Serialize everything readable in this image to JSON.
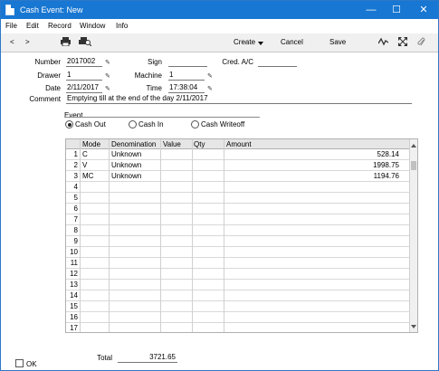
{
  "window": {
    "title": "Cash Event: New",
    "controls": {
      "minimize": "—",
      "maximize": "☐",
      "close": "✕"
    }
  },
  "menu": [
    "File",
    "Edit",
    "Record",
    "Window",
    "Info"
  ],
  "toolbar": {
    "prev": "<",
    "next": ">",
    "create_label": "Create",
    "cancel_label": "Cancel",
    "save_label": "Save"
  },
  "header": {
    "number_label": "Number",
    "number_value": "2017002",
    "drawer_label": "Drawer",
    "drawer_value": "1",
    "date_label": "Date",
    "date_value": "2/11/2017",
    "sign_label": "Sign",
    "sign_value": "",
    "machine_label": "Machine",
    "machine_value": "1",
    "time_label": "Time",
    "time_value": "17:38:04",
    "cred_label": "Cred. A/C",
    "cred_value": "",
    "comment_label": "Comment",
    "comment_value": "Emptying till at the end of the day 2/11/2017"
  },
  "event": {
    "label": "Event",
    "options": [
      "Cash Out",
      "Cash In",
      "Cash Writeoff"
    ],
    "selected": "Cash Out"
  },
  "table": {
    "columns": [
      "Mode",
      "Denomination",
      "Value",
      "Qty",
      "Amount"
    ],
    "row_numbers": [
      "1",
      "2",
      "3",
      "4",
      "5",
      "6",
      "7",
      "8",
      "9",
      "10",
      "11",
      "12",
      "13",
      "14",
      "15",
      "16",
      "17"
    ],
    "rows": [
      {
        "mode": "C",
        "denomination": "Unknown",
        "value": "",
        "qty": "",
        "amount": "528.14"
      },
      {
        "mode": "V",
        "denomination": "Unknown",
        "value": "",
        "qty": "",
        "amount": "1998.75"
      },
      {
        "mode": "MC",
        "denomination": "Unknown",
        "value": "",
        "qty": "",
        "amount": "1194.76"
      }
    ]
  },
  "footer": {
    "total_label": "Total",
    "total_value": "3721.65",
    "ok_label": "OK"
  }
}
